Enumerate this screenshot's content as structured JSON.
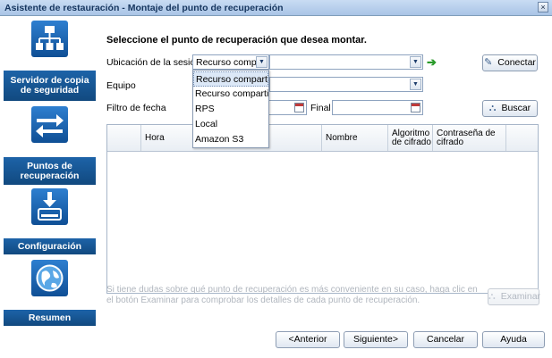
{
  "window": {
    "title": "Asistente de restauración - Montaje del punto de recuperación",
    "close_glyph": "×"
  },
  "sidebar": {
    "steps": [
      {
        "label": "Servidor de copia de seguridad",
        "icon": "network-server-icon"
      },
      {
        "label": "Puntos de recuperación",
        "icon": "swap-arrows-icon"
      },
      {
        "label": "Configuración",
        "icon": "download-disk-icon"
      },
      {
        "label": "Resumen",
        "icon": "globe-icon"
      }
    ]
  },
  "main": {
    "heading": "Seleccione el punto de recuperación que desea montar.",
    "session_location_label": "Ubicación de la sesión",
    "session_location_value": "Recurso compart",
    "connect_button": "Conectar",
    "machine_label": "Equipo",
    "date_filter_label": "Filtro de fecha",
    "end_label": "Final",
    "search_button": "Buscar",
    "table_headers": [
      "Hora",
      "Nombre",
      "Algoritmo de cifrado",
      "Contraseña de cifrado"
    ],
    "hint_text": "Si tiene dudas sobre qué punto de recuperación es más conveniente en su caso, haga clic en el botón Examinar para comprobar los detalles de cada punto de recuperación.",
    "browse_button": "Examinar"
  },
  "dropdown": {
    "options": [
      "Recurso compartid...",
      "Recurso compartid...",
      "RPS",
      "Local",
      "Amazon S3"
    ],
    "selected_index": 0
  },
  "footer": {
    "back_button": "<Anterior",
    "next_button": "Siguiente>",
    "cancel_button": "Cancelar",
    "help_button": "Ayuda"
  },
  "colors": {
    "sidebar_band": "#1d63a8",
    "title_text": "#15355e",
    "go_arrow": "#2a9b2a",
    "disabled_text": "#b3b9c2"
  }
}
